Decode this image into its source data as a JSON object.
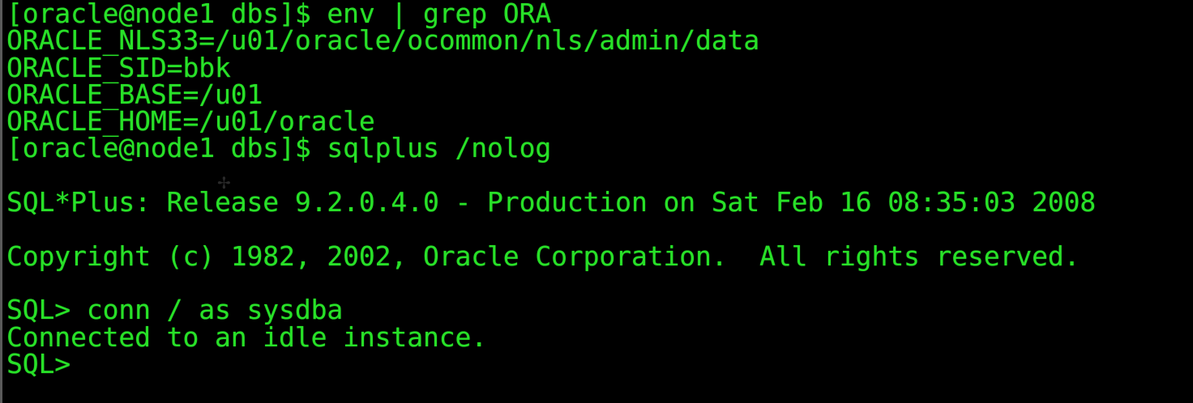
{
  "terminal": {
    "lines": [
      "[oracle@node1 dbs]$ env | grep ORA",
      "ORACLE_NLS33=/u01/oracle/ocommon/nls/admin/data",
      "ORACLE_SID=bbk",
      "ORACLE_BASE=/u01",
      "ORACLE_HOME=/u01/oracle",
      "[oracle@node1 dbs]$ sqlplus /nolog",
      "",
      "SQL*Plus: Release 9.2.0.4.0 - Production on Sat Feb 16 08:35:03 2008",
      "",
      "Copyright (c) 1982, 2002, Oracle Corporation.  All rights reserved.",
      "",
      "SQL> conn / as sysdba",
      "Connected to an idle instance.",
      "SQL>"
    ],
    "colors": {
      "background": "#000000",
      "text": "#28e128"
    }
  }
}
